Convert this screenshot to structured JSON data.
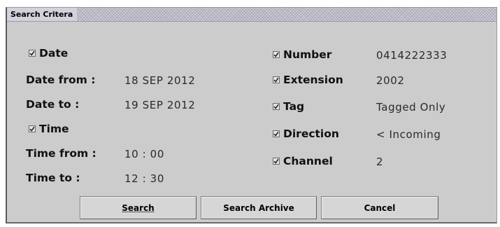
{
  "panel": {
    "title": "Search Critera"
  },
  "left": {
    "date_check": "Date",
    "date_from_label": "Date from :",
    "date_from_value": "18 SEP 2012",
    "date_to_label": "Date to :",
    "date_to_value": "19 SEP 2012",
    "time_check": "Time",
    "time_from_label": "Time from :",
    "time_from_value": "10 : 00",
    "time_to_label": "Time to :",
    "time_to_value": "12 : 30"
  },
  "right": {
    "number_label": "Number",
    "number_value": "0414222333",
    "extension_label": "Extension",
    "extension_value": "2002",
    "tag_label": "Tag",
    "tag_value": "Tagged Only",
    "direction_label": "Direction",
    "direction_value": "< Incoming",
    "channel_label": "Channel",
    "channel_value": "2"
  },
  "buttons": {
    "search": "Search",
    "search_archive": "Search Archive",
    "cancel": "Cancel"
  },
  "checkboxes": {
    "date": true,
    "time": true,
    "number": true,
    "extension": true,
    "tag": true,
    "direction": true,
    "channel": true
  },
  "icons": {
    "checkbox": "checkmark-icon"
  }
}
